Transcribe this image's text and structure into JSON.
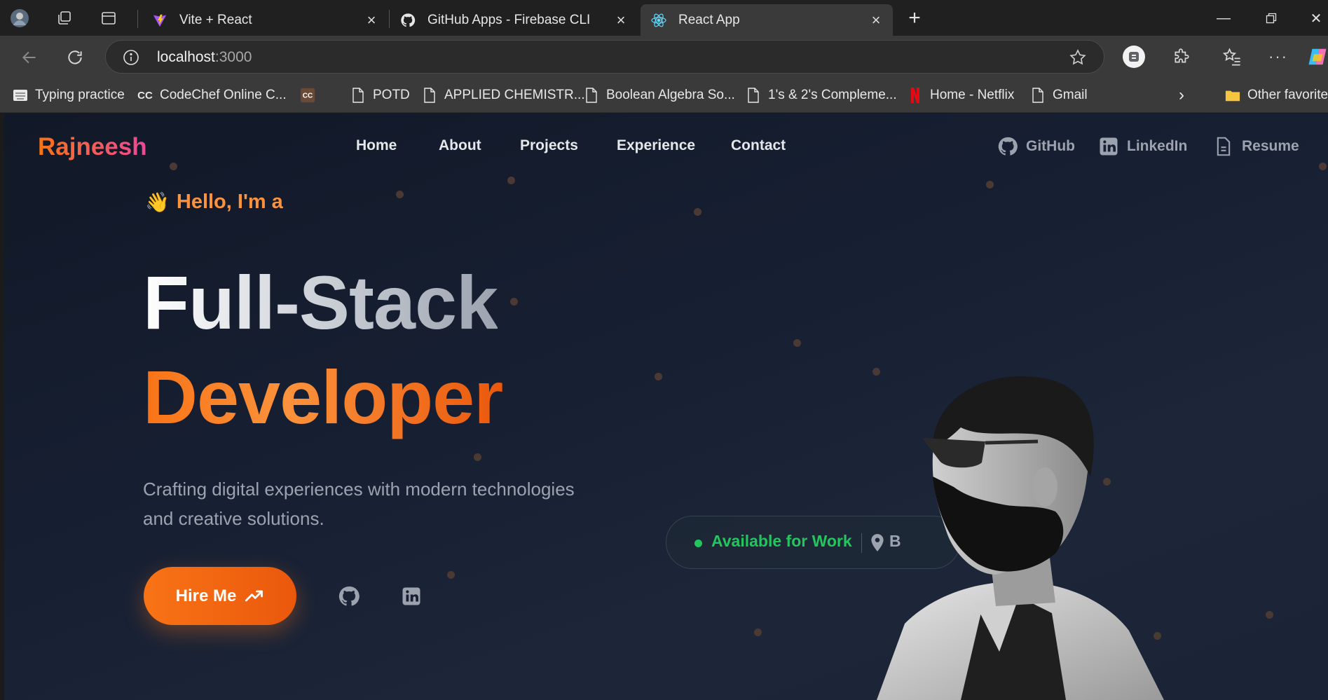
{
  "browser": {
    "tabs": [
      {
        "title": "Vite + React",
        "active": false
      },
      {
        "title": "GitHub Apps - Firebase CLI",
        "active": false
      },
      {
        "title": "React App",
        "active": true
      }
    ],
    "address": {
      "host": "localhost",
      "port": ":3000"
    },
    "bookmarks": [
      {
        "label": "Typing practice"
      },
      {
        "label": "CodeChef Online C..."
      },
      {
        "label": ""
      },
      {
        "label": "POTD"
      },
      {
        "label": "APPLIED CHEMISTR..."
      },
      {
        "label": "Boolean Algebra So..."
      },
      {
        "label": "1's & 2's Compleme..."
      },
      {
        "label": "Home - Netflix"
      },
      {
        "label": "Gmail"
      }
    ],
    "other_favorites": "Other favorites"
  },
  "site": {
    "brand": "Rajneesh",
    "nav": [
      "Home",
      "About",
      "Projects",
      "Experience",
      "Contact"
    ],
    "social": {
      "github": "GitHub",
      "linkedin": "LinkedIn",
      "resume": "Resume"
    },
    "hero": {
      "greeting": "Hello, I'm a",
      "wave": "👋",
      "title_line1": "Full-Stack",
      "title_line2": "Developer",
      "subtitle_line1": "Crafting digital experiences with modern technologies",
      "subtitle_line2": "and creative solutions.",
      "cta": "Hire Me"
    },
    "status": {
      "available": "Available for Work",
      "location": "B"
    }
  },
  "colors": {
    "accent": "#f97316",
    "brand_gradient_end": "#ec4899",
    "status_green": "#22c55e",
    "bg": "#111827"
  }
}
